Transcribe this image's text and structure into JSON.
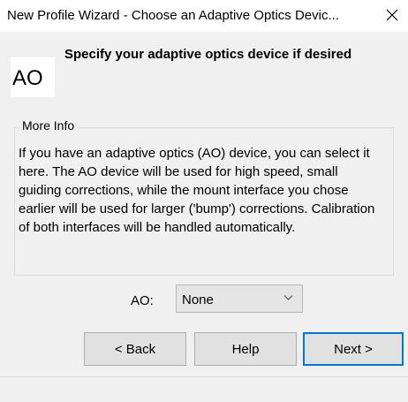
{
  "window": {
    "title": "New Profile Wizard - Choose an Adaptive Optics Devic...",
    "close_icon": "close-icon"
  },
  "header": {
    "logo_text": "AO",
    "heading": "Specify your adaptive optics device if desired"
  },
  "more_info": {
    "legend": "More Info",
    "body": "If you have an adaptive optics (AO) device, you can select it here.  The AO device will be used for high speed, small guiding corrections, while the mount interface you chose earlier will be used for larger ('bump') corrections. Calibration of both interfaces will be handled automatically."
  },
  "ao_field": {
    "label": "AO:",
    "selected": "None",
    "chevron_icon": "chevron-down-icon"
  },
  "buttons": {
    "back": "< Back",
    "help": "Help",
    "next": "Next >"
  },
  "colors": {
    "window_bg": "#f0f0f0",
    "titlebar_bg": "#ffffff",
    "button_bg": "#e1e1e1",
    "focus_accent": "#0078d7"
  }
}
